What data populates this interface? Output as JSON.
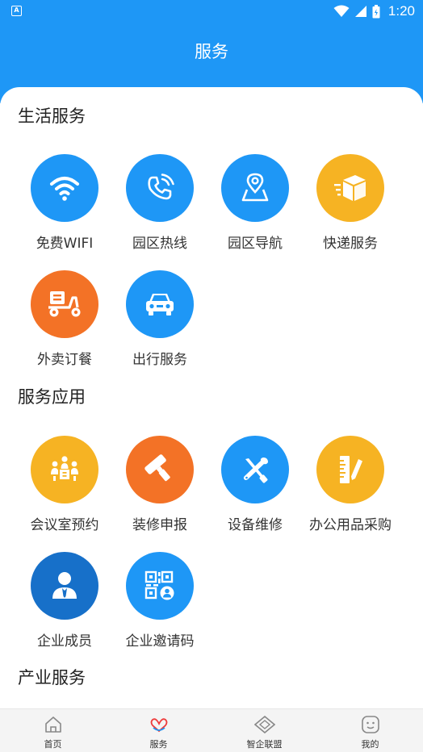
{
  "status": {
    "time": "1:20",
    "notification_glyph": "A"
  },
  "header": {
    "title": "服务"
  },
  "sections": {
    "life": {
      "title": "生活服务",
      "items": [
        {
          "label": "免费WIFI",
          "icon": "wifi-icon",
          "color": "#1e97f6"
        },
        {
          "label": "园区热线",
          "icon": "phone-icon",
          "color": "#1e97f6"
        },
        {
          "label": "园区导航",
          "icon": "map-pin-icon",
          "color": "#1e97f6"
        },
        {
          "label": "快递服务",
          "icon": "package-icon",
          "color": "#f6b323"
        },
        {
          "label": "外卖订餐",
          "icon": "scooter-icon",
          "color": "#f37226"
        },
        {
          "label": "出行服务",
          "icon": "car-icon",
          "color": "#1e97f6"
        }
      ]
    },
    "apps": {
      "title": "服务应用",
      "items": [
        {
          "label": "会议室预约",
          "icon": "meeting-icon",
          "color": "#f6b323"
        },
        {
          "label": "装修申报",
          "icon": "paint-roller-icon",
          "color": "#f37226"
        },
        {
          "label": "设备维修",
          "icon": "tools-icon",
          "color": "#1e97f6"
        },
        {
          "label": "办公用品采购",
          "icon": "ruler-pencil-icon",
          "color": "#f6b323"
        },
        {
          "label": "企业成员",
          "icon": "person-icon",
          "color": "#1770c9"
        },
        {
          "label": "企业邀请码",
          "icon": "qrcode-icon",
          "color": "#1e97f6"
        }
      ]
    },
    "industry": {
      "title": "产业服务"
    }
  },
  "tabs": [
    {
      "label": "首页",
      "icon": "home-icon"
    },
    {
      "label": "服务",
      "icon": "heart-icon",
      "active": true
    },
    {
      "label": "智企联盟",
      "icon": "diamond-icon"
    },
    {
      "label": "我的",
      "icon": "smile-icon"
    }
  ]
}
